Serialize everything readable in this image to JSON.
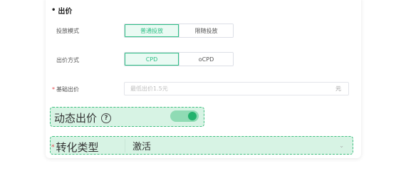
{
  "section": {
    "bullet": "•",
    "title": "出价"
  },
  "delivery_mode": {
    "label": "投放模式",
    "options": [
      "普通投放",
      "限随投放"
    ],
    "selected": "普通投放"
  },
  "bid_method": {
    "label": "出价方式",
    "options": [
      "CPD",
      "oCPD"
    ],
    "selected": "CPD"
  },
  "base_bid": {
    "required_mark": "*",
    "label": "基础出价",
    "placeholder": "最低出价1.5元",
    "unit": "元"
  },
  "dynamic_bid": {
    "label": "动态出价",
    "help_glyph": "?",
    "enabled": true
  },
  "conversion_type": {
    "required_mark": "*",
    "label": "转化类型",
    "value": "激活"
  },
  "colors": {
    "accent": "#2fbf86",
    "highlight_fill": "#d7f3e4",
    "highlight_border": "#3fbf7f",
    "required": "#e5484d"
  },
  "icons": {
    "help": "question-circle-icon",
    "dropdown": "chevron-down-icon"
  }
}
